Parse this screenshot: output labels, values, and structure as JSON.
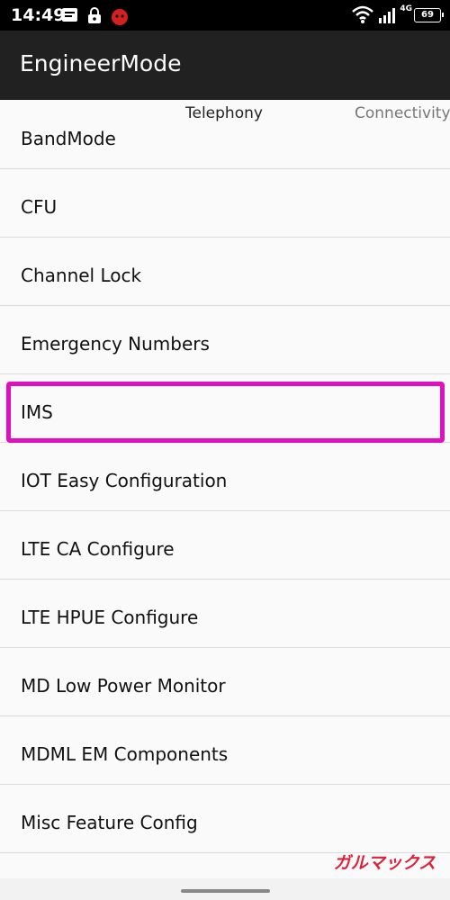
{
  "status_bar": {
    "time": "14:49",
    "network_type": "4G",
    "battery": "69",
    "icons": [
      "message-icon",
      "lock-icon",
      "app-notification-icon",
      "wifi-icon",
      "signal-icon",
      "battery-icon"
    ]
  },
  "app_bar": {
    "title": "EngineerMode"
  },
  "tabs": [
    {
      "label": "Telephony"
    },
    {
      "label": "Connectivity"
    }
  ],
  "list": {
    "items": [
      {
        "label": "BandMode"
      },
      {
        "label": "CFU"
      },
      {
        "label": "Channel Lock"
      },
      {
        "label": "Emergency Numbers"
      },
      {
        "label": "IMS"
      },
      {
        "label": "IOT Easy Configuration"
      },
      {
        "label": "LTE CA Configure"
      },
      {
        "label": "LTE HPUE Configure"
      },
      {
        "label": "MD Low Power Monitor"
      },
      {
        "label": "MDML EM Components"
      },
      {
        "label": "Misc Feature Config"
      }
    ],
    "highlighted": "IMS"
  },
  "watermark": {
    "text": "ガルマックス",
    "color": "#e0203a"
  },
  "colors": {
    "highlight": "#e010c0",
    "app_bar": "#212121",
    "status_bar": "#000000"
  }
}
